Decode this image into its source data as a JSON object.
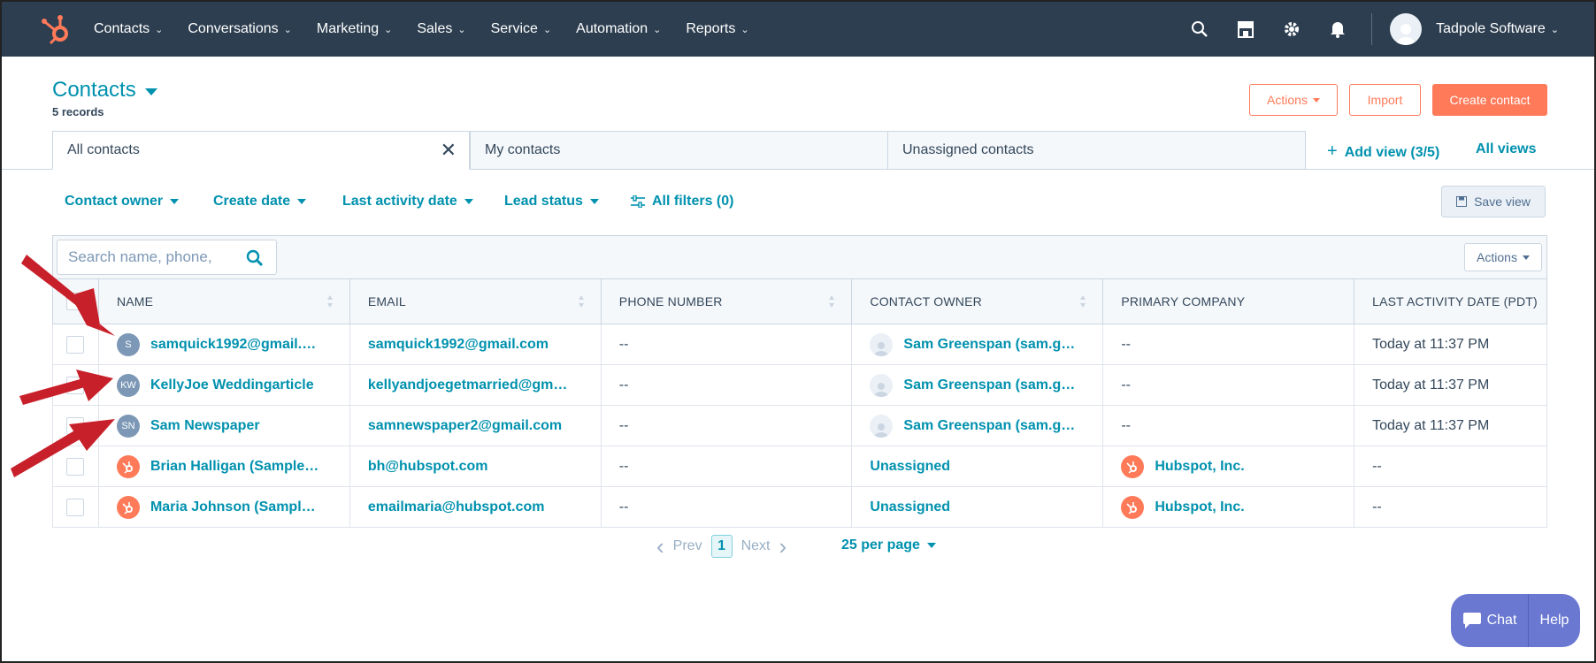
{
  "nav": {
    "items": [
      {
        "label": "Contacts",
        "name": "nav-contacts"
      },
      {
        "label": "Conversations",
        "name": "nav-conversations"
      },
      {
        "label": "Marketing",
        "name": "nav-marketing"
      },
      {
        "label": "Sales",
        "name": "nav-sales"
      },
      {
        "label": "Service",
        "name": "nav-service"
      },
      {
        "label": "Automation",
        "name": "nav-automation"
      },
      {
        "label": "Reports",
        "name": "nav-reports"
      }
    ],
    "account": "Tadpole Software",
    "icons": [
      "search-icon",
      "marketplace-icon",
      "gear-icon",
      "bell-icon"
    ]
  },
  "header": {
    "title": "Contacts",
    "records": "5 records",
    "actions_label": "Actions",
    "import_label": "Import",
    "create_label": "Create contact"
  },
  "tabs": {
    "all": "All contacts",
    "mine": "My contacts",
    "unassigned": "Unassigned contacts",
    "add_view": "Add view (3/5)",
    "all_views": "All views"
  },
  "filters": {
    "owner": "Contact owner",
    "create_date": "Create date",
    "last_activity": "Last activity date",
    "lead_status": "Lead status",
    "all_filters": "All filters (0)",
    "save_view": "Save view"
  },
  "table": {
    "search_placeholder": "Search name, phone,",
    "actions_label": "Actions",
    "headers": {
      "name": "NAME",
      "email": "EMAIL",
      "phone": "PHONE NUMBER",
      "owner": "CONTACT OWNER",
      "company": "PRIMARY COMPANY",
      "last_activity": "LAST ACTIVITY DATE (PDT)"
    },
    "rows": [
      {
        "initials": "S",
        "name": "samquick1992@gmail.…",
        "email": "samquick1992@gmail.com",
        "phone": "--",
        "owner": "Sam Greenspan (sam.g…",
        "company": "--",
        "last_activity": "Today at 11:37 PM"
      },
      {
        "initials": "KW",
        "name": "KellyJoe Weddingarticle",
        "email": "kellyandjoegetmarried@gm…",
        "phone": "--",
        "owner": "Sam Greenspan (sam.g…",
        "company": "--",
        "last_activity": "Today at 11:37 PM"
      },
      {
        "initials": "SN",
        "name": "Sam Newspaper",
        "email": "samnewspaper2@gmail.com",
        "phone": "--",
        "owner": "Sam Greenspan (sam.g…",
        "company": "--",
        "last_activity": "Today at 11:37 PM"
      },
      {
        "initials": "",
        "name": "Brian Halligan (Sample…",
        "email": "bh@hubspot.com",
        "phone": "--",
        "owner": "Unassigned",
        "company": "Hubspot, Inc.",
        "last_activity": "--"
      },
      {
        "initials": "",
        "name": "Maria Johnson (Sampl…",
        "email": "emailmaria@hubspot.com",
        "phone": "--",
        "owner": "Unassigned",
        "company": "Hubspot, Inc.",
        "last_activity": "--"
      }
    ]
  },
  "pagination": {
    "prev": "Prev",
    "page": "1",
    "next": "Next",
    "per_page": "25 per page"
  },
  "chat": {
    "chat_label": "Chat",
    "help_label": "Help"
  },
  "colors": {
    "nav_bg": "#2d3e50",
    "link": "#0091ae",
    "accent": "#ff7a59",
    "chat": "#6a78d1",
    "arrow": "#c8202b"
  }
}
